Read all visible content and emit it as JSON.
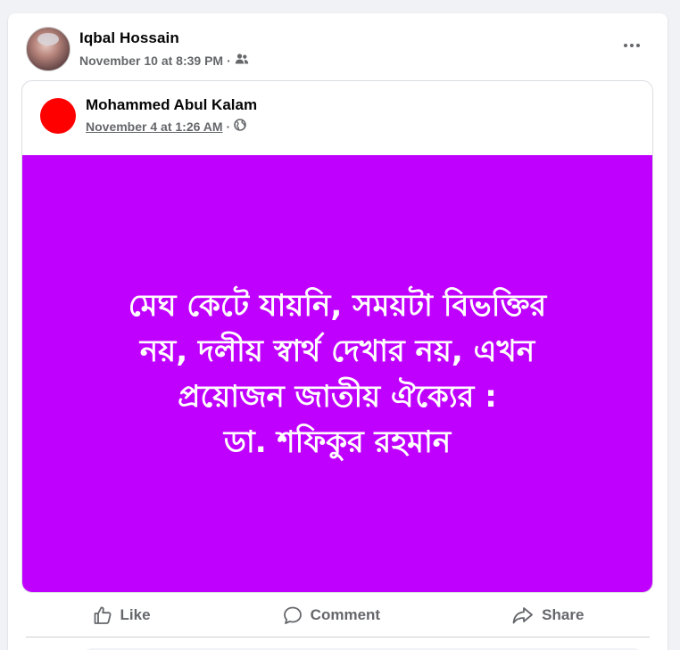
{
  "post": {
    "author": "Iqbal Hossain",
    "timestamp": "November 10 at 8:39 PM",
    "separator": "·",
    "audience_icon": "friends-icon",
    "more_icon": "more-horizontal-icon"
  },
  "shared_post": {
    "author": "Mohammed Abul Kalam",
    "timestamp": "November 4 at 1:26 AM",
    "separator": "·",
    "audience_icon": "globe-icon",
    "avatar_color": "#ff0000",
    "image_background": "#c000ff",
    "image_text": "মেঘ কেটে যায়নি, সময়টা বিভক্তির\nনয়, দলীয় স্বার্থ দেখার নয়, এখন\nপ্রয়োজন জাতীয় ঐক্যের :\nডা. শফিকুর রহমান"
  },
  "actions": {
    "like": "Like",
    "comment": "Comment",
    "share": "Share"
  },
  "colors": {
    "secondary_text": "#65676b",
    "page_background": "#f0f2f5"
  }
}
